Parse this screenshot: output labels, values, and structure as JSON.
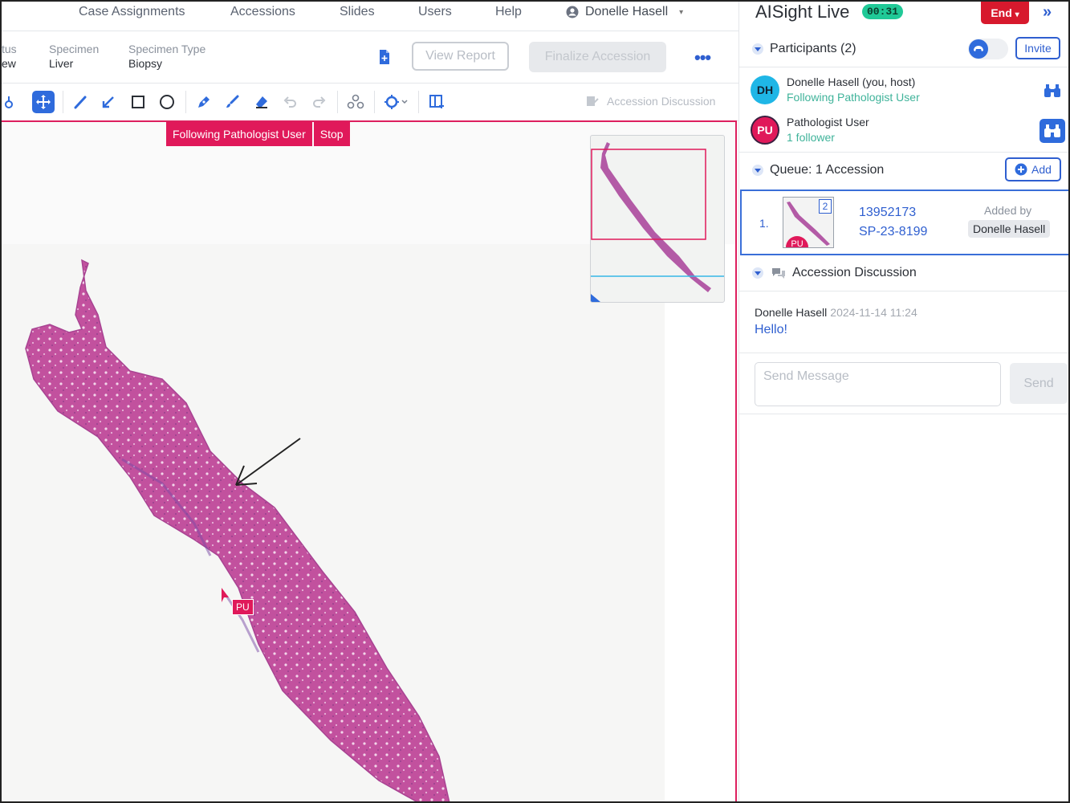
{
  "nav": {
    "items": [
      "Case Assignments",
      "Accessions",
      "Slides",
      "Users",
      "Help"
    ],
    "user_name": "Donelle Hasell",
    "caret": "▾"
  },
  "case": {
    "status_label": "tus",
    "status_value": "ew",
    "specimen_label": "Specimen",
    "specimen_value": "Liver",
    "type_label": "Specimen Type",
    "type_value": "Biopsy",
    "view_report": "View Report",
    "finalize": "Finalize Accession",
    "more": "•••"
  },
  "toolbar": {
    "accession_discussion": "Accession Discussion"
  },
  "viewer": {
    "following_label": "Following Pathologist User",
    "stop_label": "Stop",
    "cursor_tag": "PU"
  },
  "live": {
    "title": "AISight Live",
    "timer": "00:31",
    "end_label": "End",
    "end_caret": "▾",
    "collapse": "»",
    "participants_title": "Participants (2)",
    "invite_label": "Invite",
    "participants": [
      {
        "initials": "DH",
        "name": "Donelle Hasell (you, host)",
        "status": "Following Pathologist User",
        "color": "#1fb6e6"
      },
      {
        "initials": "PU",
        "name": "Pathologist User",
        "status": "1 follower",
        "color": "#e0195a"
      }
    ],
    "queue_title": "Queue: 1 Accession",
    "add_label": "Add",
    "queue": [
      {
        "index": "1.",
        "slide_count": "2",
        "avatar": "PU",
        "id": "13952173",
        "accession": "SP-23-8199",
        "added_by_label": "Added by",
        "added_by": "Donelle Hasell"
      }
    ],
    "discussion_title": "Accession Discussion",
    "messages": [
      {
        "author": "Donelle Hasell",
        "time": "2024-11-14 11:24",
        "text": "Hello!"
      }
    ],
    "message_placeholder": "Send Message",
    "send_label": "Send"
  },
  "colors": {
    "accent": "#2f6bdc",
    "live_pink": "#e0195a",
    "end_red": "#d7192d",
    "timer_green": "#20c997"
  }
}
